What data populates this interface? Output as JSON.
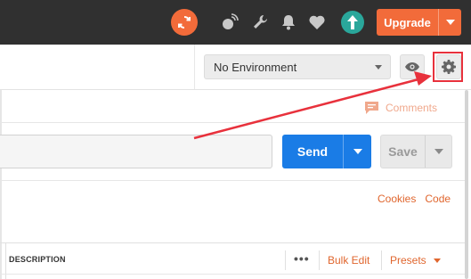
{
  "colors": {
    "topbar": "#303030",
    "accent": "#f26b3a",
    "send_blue": "#1a7ce6",
    "avatar": "#2aa79b",
    "annotation_red": "#e8313c"
  },
  "header": {
    "sync_icon": "sync-icon",
    "icons": [
      "satellite-icon",
      "wrench-icon",
      "bell-icon",
      "heart-icon"
    ],
    "avatar_icon": "user-avatar-icon",
    "upgrade_label": "Upgrade"
  },
  "environment": {
    "selected": "No Environment",
    "quick_look_icon": "eye-icon",
    "settings_icon": "gear-icon"
  },
  "comments": {
    "label": "Comments"
  },
  "request": {
    "url_value": "",
    "send_label": "Send",
    "save_label": "Save"
  },
  "links": {
    "cookies": "Cookies",
    "code": "Code"
  },
  "params_table": {
    "column_description": "DESCRIPTION",
    "more_label": "•••",
    "bulk_edit": "Bulk Edit",
    "presets": "Presets"
  }
}
